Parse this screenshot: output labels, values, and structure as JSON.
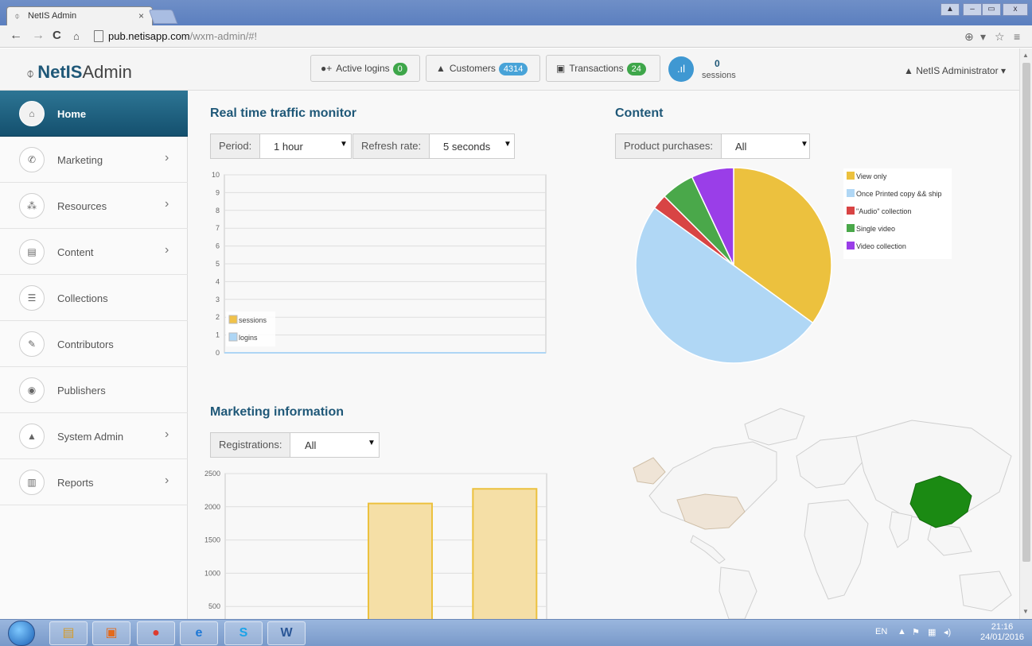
{
  "browser": {
    "tab_title": "NetIS Admin",
    "tab_close": "×",
    "url_host": "pub.netisapp.com",
    "url_path": "/wxm-admin/#!",
    "back": "←",
    "forward": "→",
    "reload": "C",
    "home": "🏠"
  },
  "header": {
    "logo_bold": "NetIS",
    "logo_rest": "Admin",
    "active_logins_label": "Active logins",
    "active_logins_count": "0",
    "customers_label": "Customers",
    "customers_count": "4314",
    "transactions_label": "Transactions",
    "transactions_count": "24",
    "sessions_count": "0",
    "sessions_label": "sessions",
    "user": "NetIS Administrator"
  },
  "sidebar": {
    "items": [
      {
        "label": "Home",
        "icon": "home-icon"
      },
      {
        "label": "Marketing",
        "icon": "phone-icon"
      },
      {
        "label": "Resources",
        "icon": "cubes-icon"
      },
      {
        "label": "Content",
        "icon": "list-alt-icon"
      },
      {
        "label": "Collections",
        "icon": "list-icon"
      },
      {
        "label": "Contributors",
        "icon": "pencil-icon"
      },
      {
        "label": "Publishers",
        "icon": "globe-icon"
      },
      {
        "label": "System Admin",
        "icon": "user-icon"
      },
      {
        "label": "Reports",
        "icon": "bar-chart-icon"
      }
    ]
  },
  "traffic": {
    "title": "Real time traffic monitor",
    "period_label": "Period:",
    "period_value": "1 hour",
    "refresh_label": "Refresh rate:",
    "refresh_value": "5 seconds"
  },
  "content_section": {
    "title": "Content",
    "filter_label": "Product purchases:",
    "filter_value": "All"
  },
  "marketing": {
    "title": "Marketing information",
    "filter_label": "Registrations:",
    "filter_value": "All"
  },
  "colors": {
    "accent": "#1f5878",
    "sessions": "#f0c24a",
    "logins": "#aed6f5",
    "badge_green": "#3ea64a",
    "badge_blue": "#48a3d8",
    "map_highlight": "#1b8a13"
  },
  "taskbar": {
    "lang": "EN",
    "time": "21:16",
    "date": "24/01/2016"
  },
  "chart_data": [
    {
      "type": "line",
      "title": "Real time traffic monitor",
      "ylim": [
        0,
        10
      ],
      "yticks": [
        "0",
        "1",
        "2",
        "3",
        "4",
        "5",
        "6",
        "7",
        "8",
        "9",
        "10"
      ],
      "series": [
        {
          "name": "sessions",
          "color": "#f0c24a",
          "values": [
            0,
            0
          ]
        },
        {
          "name": "logins",
          "color": "#aed6f5",
          "values": [
            0,
            0
          ]
        }
      ],
      "legend": "bottom-left"
    },
    {
      "type": "pie",
      "title": "Content",
      "slices": [
        {
          "name": "View only",
          "value": 35,
          "color": "#ecc13e"
        },
        {
          "name": "Once Printed copy && ship",
          "value": 50,
          "color": "#b0d7f5"
        },
        {
          "name": "\"Audio\" collection",
          "value": 2.5,
          "color": "#d84444"
        },
        {
          "name": "Single video",
          "value": 5.5,
          "color": "#4aa84a"
        },
        {
          "name": "Video collection",
          "value": 7,
          "color": "#9a3ee8"
        }
      ],
      "legend": "right"
    },
    {
      "type": "bar",
      "title": "Marketing information",
      "ylim": [
        0,
        2500
      ],
      "yticks": [
        "500",
        "1000",
        "1500",
        "2000",
        "2500"
      ],
      "values": [
        0,
        2050,
        2270
      ],
      "color": "#f5dfa6",
      "border": "#ecc13e"
    }
  ]
}
